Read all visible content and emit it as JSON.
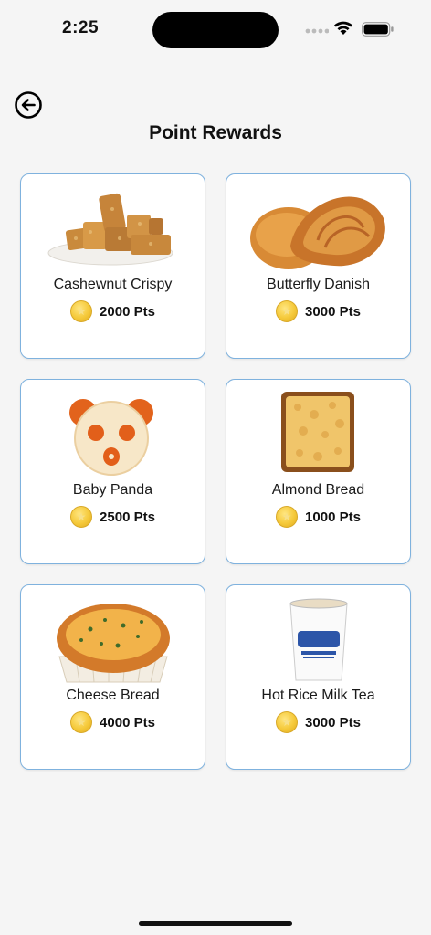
{
  "status": {
    "time": "2:25"
  },
  "header": {
    "title": "Point Rewards"
  },
  "rewards": [
    {
      "name": "Cashewnut Crispy",
      "points": "2000 Pts"
    },
    {
      "name": "Butterfly Danish",
      "points": "3000 Pts"
    },
    {
      "name": "Baby Panda",
      "points": "2500 Pts"
    },
    {
      "name": "Almond Bread",
      "points": "1000 Pts"
    },
    {
      "name": "Cheese Bread",
      "points": "4000 Pts"
    },
    {
      "name": "Hot Rice Milk Tea",
      "points": "3000 Pts"
    }
  ],
  "colors": {
    "background": "#f5f5f5",
    "card_border": "#7fb2de",
    "coin": "#f5c93a"
  },
  "icons": [
    "back-arrow-icon",
    "coin-icon",
    "signal-icon",
    "wifi-icon",
    "battery-icon"
  ]
}
